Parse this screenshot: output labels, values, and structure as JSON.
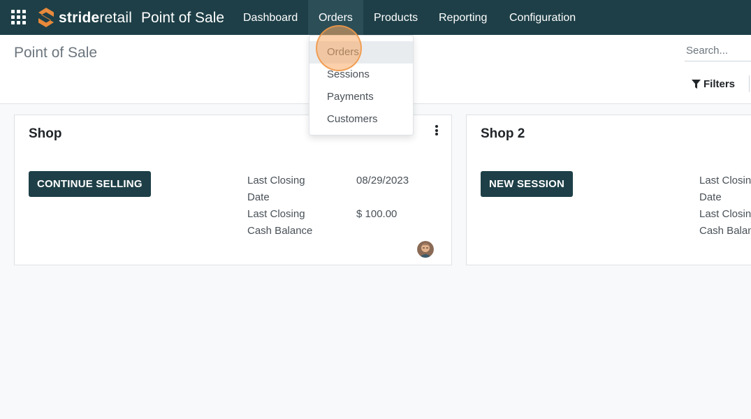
{
  "app": {
    "brand_bold": "stride",
    "brand_light": "retail",
    "title": "Point of Sale"
  },
  "nav": {
    "items": [
      {
        "label": "Dashboard"
      },
      {
        "label": "Orders"
      },
      {
        "label": "Products"
      },
      {
        "label": "Reporting"
      },
      {
        "label": "Configuration"
      }
    ]
  },
  "orders_menu": {
    "items": [
      {
        "label": "Orders"
      },
      {
        "label": "Sessions"
      },
      {
        "label": "Payments"
      },
      {
        "label": "Customers"
      }
    ]
  },
  "control_panel": {
    "page_title": "Point of Sale",
    "search_placeholder": "Search...",
    "filters_label": "Filters"
  },
  "cards": [
    {
      "name": "Shop",
      "button_label": "CONTINUE SELLING",
      "last_closing_date_label": "Last Closing Date",
      "last_closing_date": "08/29/2023",
      "last_closing_cash_label": "Last Closing Cash Balance",
      "last_closing_cash": "$ 100.00"
    },
    {
      "name": "Shop 2",
      "button_label": "NEW SESSION",
      "last_closing_date_label": "Last Closing Date",
      "last_closing_cash_label": "Last Closing Cash Balance"
    }
  ],
  "colors": {
    "navbar": "#1e3f47",
    "primary_button": "#1e3f47",
    "brand_accent": "#e8893a",
    "click_highlight": "#f7aa64"
  },
  "icons": {
    "apps": "grid-icon",
    "filter": "filter-icon",
    "kebab": "vertical-dots-icon",
    "avatar": "user-avatar"
  }
}
